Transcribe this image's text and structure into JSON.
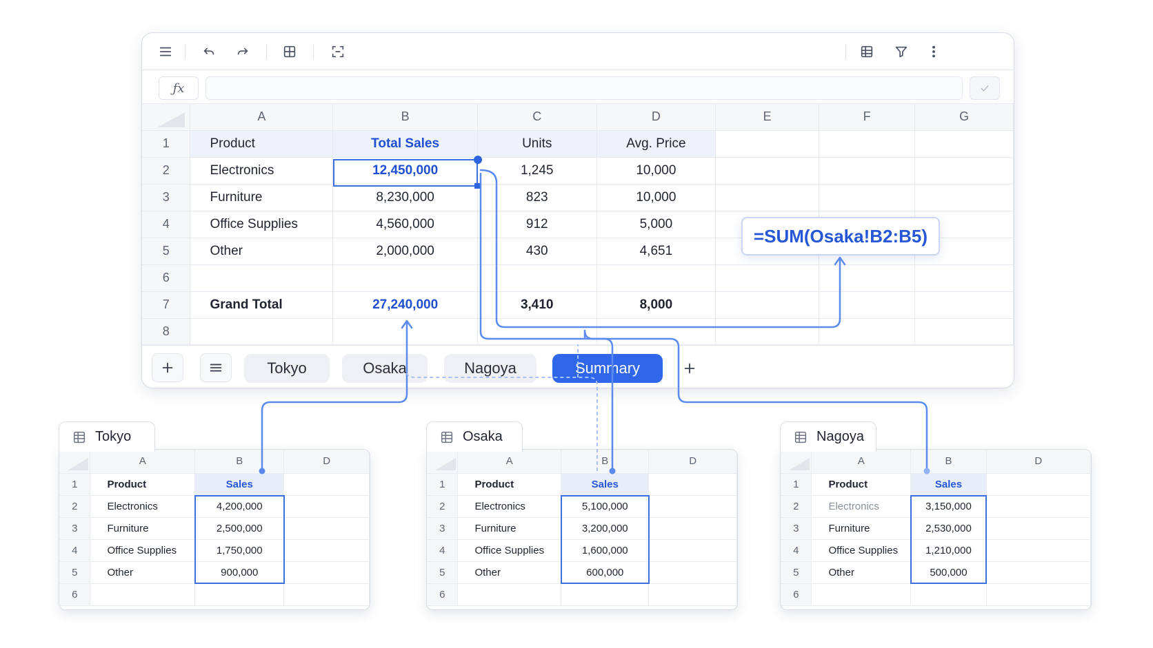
{
  "toolbar": {
    "icons": [
      "menu-icon",
      "undo-icon",
      "redo-icon",
      "table-icon",
      "select-icon",
      "grid-view-icon",
      "filter-icon",
      "more-icon"
    ]
  },
  "formula_bar": {
    "fx_label": "ƒx",
    "value": ""
  },
  "main_grid": {
    "columns": [
      "A",
      "B",
      "C",
      "D",
      "E",
      "F",
      "G"
    ],
    "rows": [
      {
        "n": "1",
        "a": "Product",
        "b": "Total Sales",
        "c": "Units",
        "d": "Avg. Price"
      },
      {
        "n": "2",
        "a": "Electronics",
        "b": "12,450,000",
        "c": "1,245",
        "d": "10,000"
      },
      {
        "n": "3",
        "a": "Furniture",
        "b": "8,230,000",
        "c": "823",
        "d": "10,000"
      },
      {
        "n": "4",
        "a": "Office Supplies",
        "b": "4,560,000",
        "c": "912",
        "d": "5,000"
      },
      {
        "n": "5",
        "a": "Other",
        "b": "2,000,000",
        "c": "430",
        "d": "4,651"
      },
      {
        "n": "6",
        "a": "",
        "b": "",
        "c": "",
        "d": ""
      },
      {
        "n": "7",
        "a": "Grand Total",
        "b": "27,240,000",
        "c": "3,410",
        "d": "8,000"
      },
      {
        "n": "8",
        "a": "",
        "b": "",
        "c": "",
        "d": ""
      }
    ]
  },
  "formula_callout": "=SUM(Osaka!B2:B5)",
  "sheet_tabs": [
    "Tokyo",
    "Osaka",
    "Nagoya",
    "Summary"
  ],
  "active_tab": "Summary",
  "mini_sheets": [
    {
      "name": "Tokyo",
      "columns": [
        "A",
        "B",
        "D"
      ],
      "rows": [
        {
          "n": "1",
          "a": "Product",
          "b": "Sales"
        },
        {
          "n": "2",
          "a": "Electronics",
          "b": "4,200,000"
        },
        {
          "n": "3",
          "a": "Furniture",
          "b": "2,500,000"
        },
        {
          "n": "4",
          "a": "Office Supplies",
          "b": "1,750,000"
        },
        {
          "n": "5",
          "a": "Other",
          "b": "900,000"
        },
        {
          "n": "6",
          "a": "",
          "b": ""
        }
      ]
    },
    {
      "name": "Osaka",
      "columns": [
        "A",
        "B",
        "D"
      ],
      "rows": [
        {
          "n": "1",
          "a": "Product",
          "b": "Sales"
        },
        {
          "n": "2",
          "a": "Electronics",
          "b": "5,100,000"
        },
        {
          "n": "3",
          "a": "Furniture",
          "b": "3,200,000"
        },
        {
          "n": "4",
          "a": "Office Supplies",
          "b": "1,600,000"
        },
        {
          "n": "5",
          "a": "Other",
          "b": "600,000"
        },
        {
          "n": "6",
          "a": "",
          "b": ""
        }
      ]
    },
    {
      "name": "Nagoya",
      "columns": [
        "A",
        "B",
        "D"
      ],
      "rows": [
        {
          "n": "1",
          "a": "Product",
          "b": "Sales"
        },
        {
          "n": "2",
          "a": "Electronics",
          "b": "3,150,000"
        },
        {
          "n": "3",
          "a": "Furniture",
          "b": "2,530,000"
        },
        {
          "n": "4",
          "a": "Office Supplies",
          "b": "1,210,000"
        },
        {
          "n": "5",
          "a": "Other",
          "b": "500,000"
        },
        {
          "n": "6",
          "a": "",
          "b": ""
        }
      ]
    }
  ],
  "colors": {
    "accent": "#2f66ea",
    "selection": "#3a6fe0",
    "connector": "#5a8bec",
    "value_text": "#1f4fd1"
  }
}
